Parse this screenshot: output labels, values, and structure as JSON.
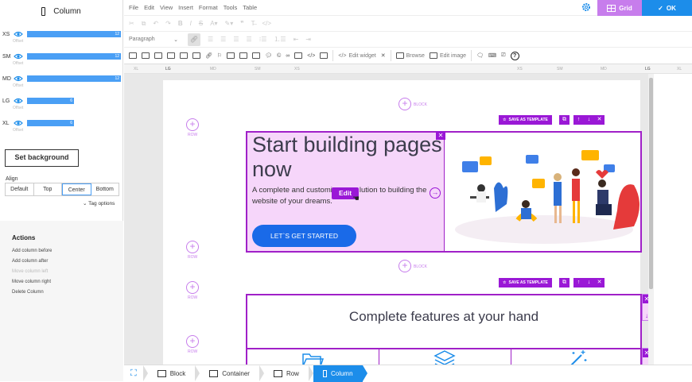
{
  "sidebar": {
    "title": "Column",
    "breakpoints": [
      {
        "label": "XS",
        "span": "12",
        "fill": 1.0,
        "offset_label": "Offset"
      },
      {
        "label": "SM",
        "span": "12",
        "fill": 1.0,
        "offset_label": "Offset"
      },
      {
        "label": "MD",
        "span": "12",
        "fill": 1.0,
        "offset_label": "Offset"
      },
      {
        "label": "LG",
        "span": "6",
        "fill": 0.5,
        "offset_label": "Offset"
      },
      {
        "label": "XL",
        "span": "6",
        "fill": 0.5,
        "offset_label": "Offset"
      }
    ],
    "set_background": "Set background",
    "align_label": "Align",
    "align_options": [
      "Default",
      "Top",
      "Center",
      "Bottom"
    ],
    "align_selected": "Center",
    "tag_options": "Tag options",
    "actions_title": "Actions",
    "actions": [
      {
        "label": "Add column before",
        "enabled": true
      },
      {
        "label": "Add column after",
        "enabled": true
      },
      {
        "label": "Move column left",
        "enabled": false
      },
      {
        "label": "Move column right",
        "enabled": true
      },
      {
        "label": "Delete Column",
        "enabled": true
      }
    ]
  },
  "menubar": {
    "items": [
      "File",
      "Edit",
      "View",
      "Insert",
      "Format",
      "Tools",
      "Table"
    ]
  },
  "header": {
    "grid_label": "Grid",
    "ok_label": "OK",
    "grid_color": "#c77dec",
    "ok_color": "#1c8dea"
  },
  "toolbar": {
    "paragraph": "Paragraph",
    "edit_widget": "Edit widget",
    "browse": "Browse",
    "edit_image": "Edit image"
  },
  "ruler": {
    "labels": [
      "XL",
      "LG",
      "MD",
      "SM",
      "XS",
      "XS",
      "SM",
      "MD",
      "LG",
      "XL"
    ]
  },
  "canvas": {
    "block_label": "BLOCK",
    "row_label": "ROW",
    "save_template": "SAVE AS TEMPLATE",
    "hero_heading": "Start building pages now",
    "hero_text_a": "A complete and customi",
    "hero_text_b": "lution to building the website of your dreams.",
    "edit_label": "Edit",
    "cta_label": "LET`S GET STARTED",
    "features_heading": "Complete features at your hand",
    "accent_color": "#9a18d6"
  },
  "breadcrumbs": [
    {
      "label": "Block",
      "active": false
    },
    {
      "label": "Container",
      "active": false
    },
    {
      "label": "Row",
      "active": false
    },
    {
      "label": "Column",
      "active": true
    }
  ]
}
